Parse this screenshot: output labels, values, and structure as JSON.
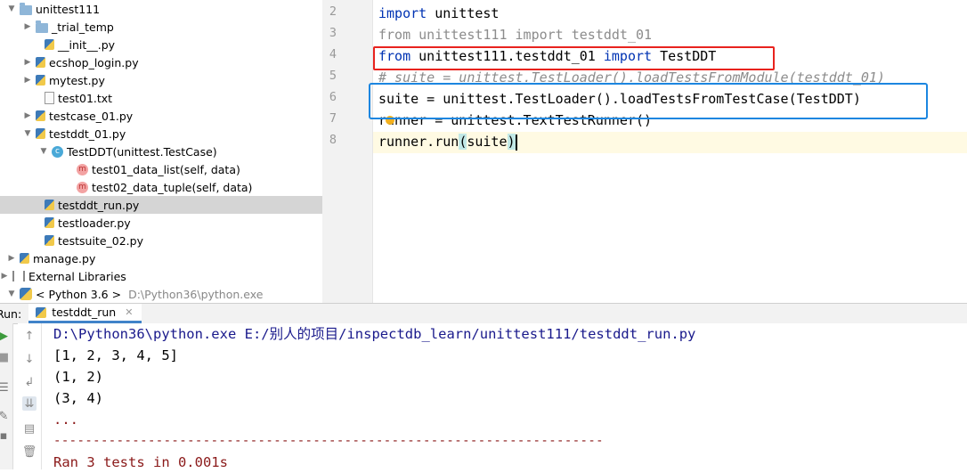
{
  "tree": {
    "items": [
      {
        "label": "unittest111",
        "kind": "folder",
        "depth": 0,
        "expanded": true
      },
      {
        "label": "_trial_temp",
        "kind": "folder",
        "depth": 1,
        "expanded": false
      },
      {
        "label": "__init__.py",
        "kind": "py",
        "depth": 1
      },
      {
        "label": "ecshop_login.py",
        "kind": "py",
        "depth": 1,
        "expandable": true
      },
      {
        "label": "mytest.py",
        "kind": "py",
        "depth": 1,
        "expandable": true
      },
      {
        "label": "test01.txt",
        "kind": "txt",
        "depth": 1
      },
      {
        "label": "testcase_01.py",
        "kind": "py",
        "depth": 1,
        "expandable": true
      },
      {
        "label": "testddt_01.py",
        "kind": "py",
        "depth": 1,
        "expanded": true
      },
      {
        "label": "TestDDT(unittest.TestCase)",
        "kind": "class",
        "depth": 2,
        "expanded": true
      },
      {
        "label": "test01_data_list(self, data)",
        "kind": "method",
        "depth": 3
      },
      {
        "label": "test02_data_tuple(self, data)",
        "kind": "method",
        "depth": 3
      },
      {
        "label": "testddt_run.py",
        "kind": "py",
        "depth": 1,
        "selected": true
      },
      {
        "label": "testloader.py",
        "kind": "py",
        "depth": 1
      },
      {
        "label": "testsuite_02.py",
        "kind": "py",
        "depth": 1
      },
      {
        "label": "manage.py",
        "kind": "py",
        "depth": 0,
        "expandable": true
      },
      {
        "label": "External Libraries",
        "kind": "lib",
        "depth": 0,
        "expandable": true
      },
      {
        "label": "< Python 3.6 >",
        "kind": "python",
        "depth": 1,
        "expanded": true,
        "path": "D:\\Python36\\python.exe"
      }
    ]
  },
  "editor": {
    "line_numbers": [
      "2",
      "3",
      "4",
      "5",
      "6",
      "7",
      "8"
    ],
    "lines": {
      "l2_kw": "import",
      "l2_rest": " unittest",
      "l3": "from unittest111 import testddt_01",
      "l4_kw1": "from",
      "l4_mid": " unittest111.testddt_01 ",
      "l4_kw2": "import",
      "l4_end": " TestDDT",
      "l5": "# suite = unittest.TestLoader().loadTestsFromModule(testddt_01)",
      "l6": "suite = unittest.TestLoader().loadTestsFromTestCase(TestDDT)",
      "l7": "runner = unittest.TextTestRunner()",
      "l8_a": "runner.run",
      "l8_p1": "(",
      "l8_b": "suite",
      "l8_p2": ")"
    }
  },
  "run": {
    "label": "Run:",
    "tab": "testddt_run"
  },
  "console": {
    "lines": [
      {
        "text": "D:\\Python36\\python.exe E:/别人的项目/inspectdb_learn/unittest111/testddt_run.py",
        "style": "navy"
      },
      {
        "text": "[1, 2, 3, 4, 5]",
        "style": "plain"
      },
      {
        "text": "(1, 2)",
        "style": "plain"
      },
      {
        "text": "(3, 4)",
        "style": "plain"
      },
      {
        "text": "...",
        "style": "darkred"
      },
      {
        "text": "----------------------------------------------------------------------",
        "style": "darkred"
      },
      {
        "text": "Ran 3 tests in 0.001s",
        "style": "darkred"
      }
    ]
  },
  "icons": {
    "play": "play-icon",
    "up": "arrow-up-icon",
    "down": "arrow-down-icon",
    "wrap": "soft-wrap-icon",
    "scroll_end": "scroll-to-end-icon",
    "print": "print-icon",
    "trash": "trash-icon",
    "pin": "pin-icon"
  },
  "colors": {
    "red_box": "#e8231e",
    "blue_box": "#1c86e0",
    "keyword": "#0033b3"
  }
}
